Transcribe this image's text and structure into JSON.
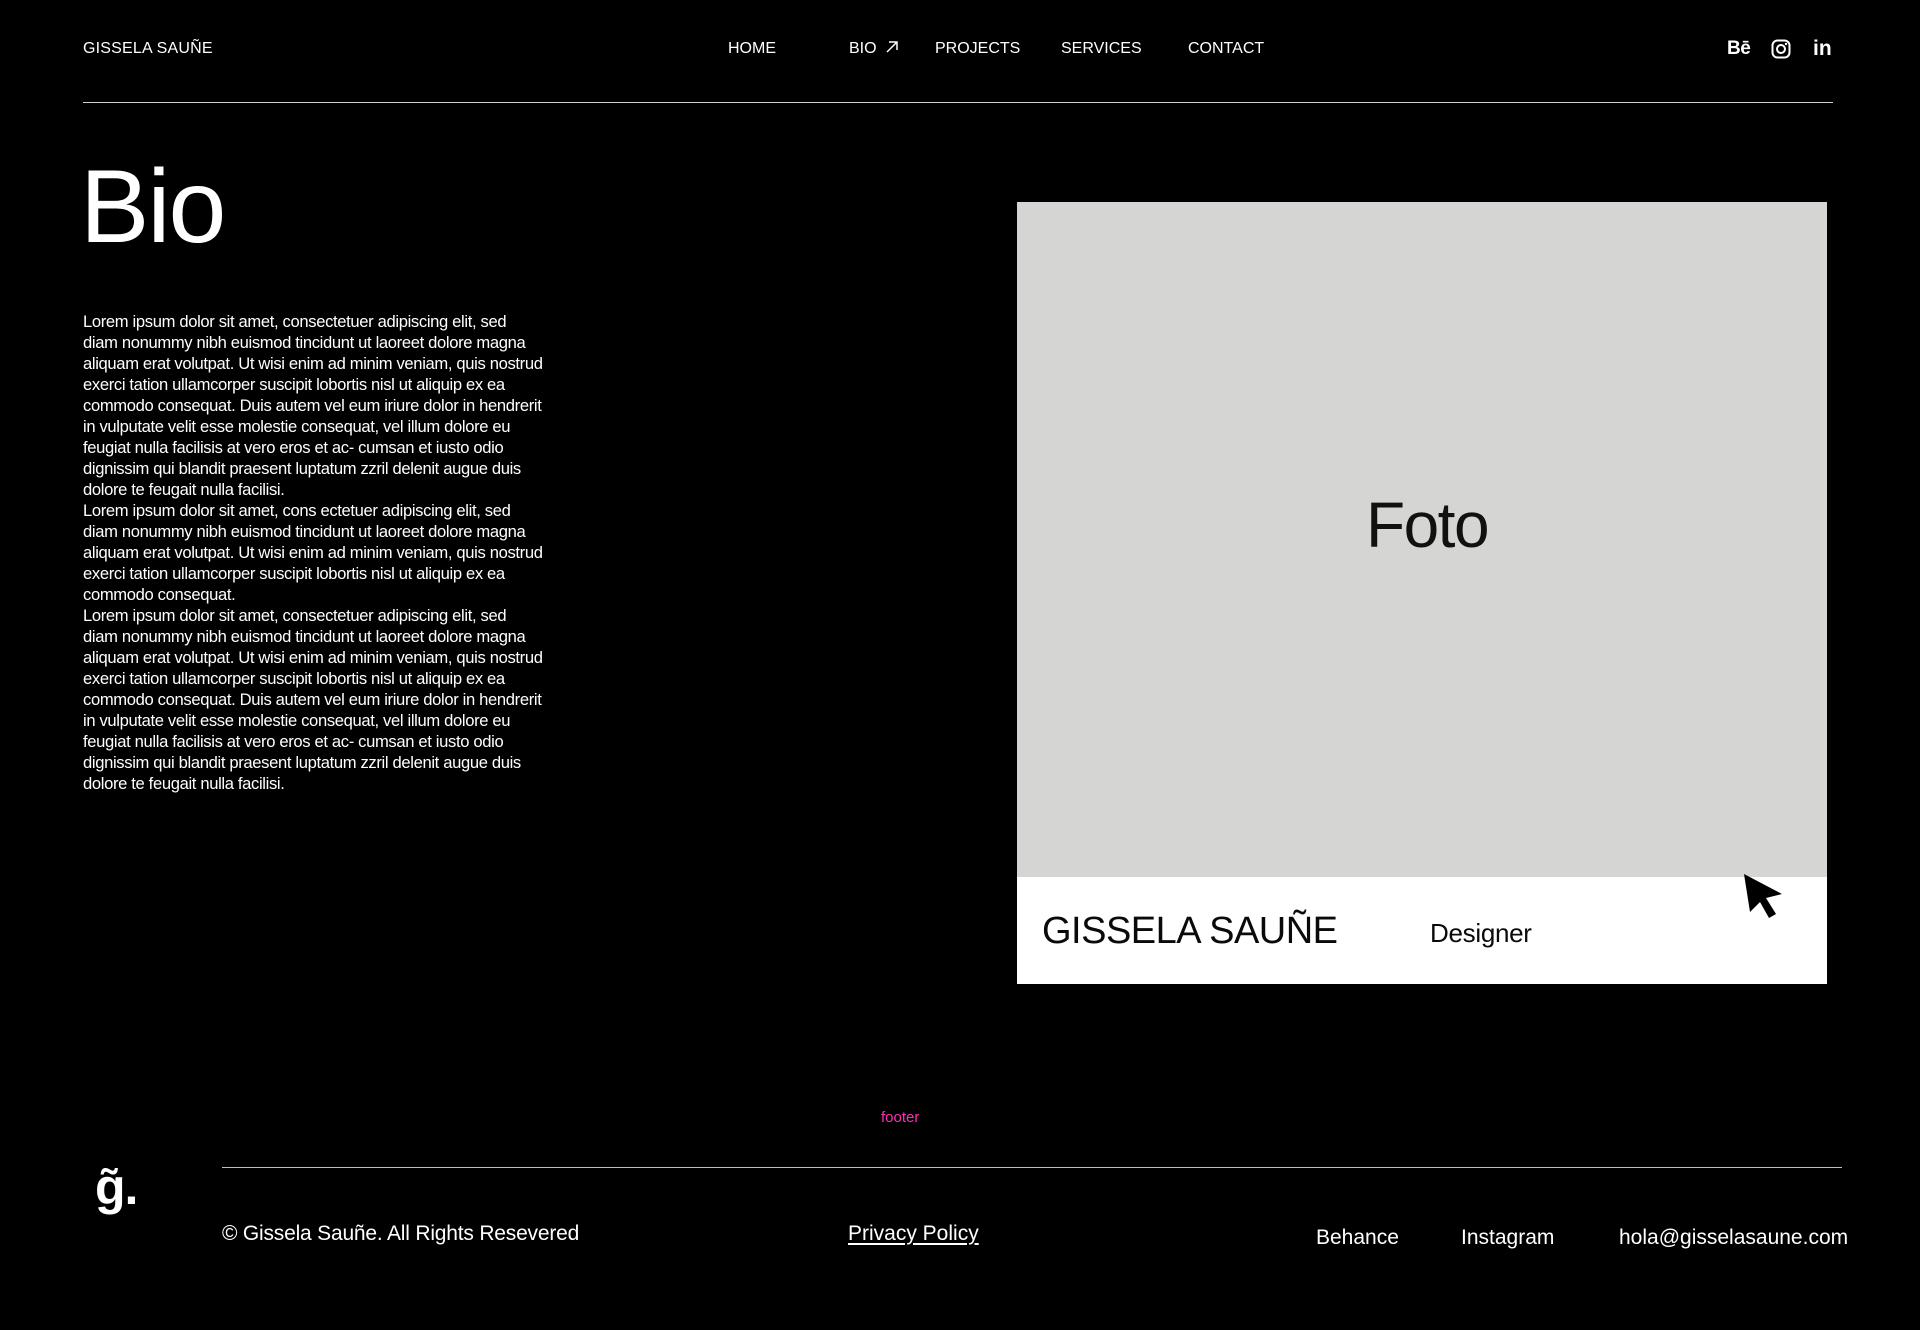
{
  "header": {
    "brand": "GISSELA SAUÑE",
    "nav": {
      "home": "HOME",
      "bio": "BIO",
      "projects": "PROJECTS",
      "services": "SERVICES",
      "contact": "CONTACT"
    },
    "social": {
      "behance": "Bē",
      "linkedin": "in"
    }
  },
  "main": {
    "title": "Bio",
    "paragraphs": [
      "Lorem ipsum dolor sit amet, consectetuer adipiscing elit, sed diam nonummy nibh euismod tincidunt ut laoreet dolore magna aliquam erat volutpat. Ut wisi enim ad minim veniam, quis nostrud exerci tation ullamcorper suscipit lobortis nisl ut aliquip ex ea commodo consequat. Duis autem vel eum iriure dolor in hendrerit in vulputate velit esse molestie consequat, vel illum dolore eu feugiat nulla facilisis at vero eros et ac- cumsan et iusto odio dignissim qui blandit praesent luptatum zzril delenit augue duis dolore te feugait nulla facilisi.",
      "Lorem ipsum dolor sit amet, cons ectetuer adipiscing elit, sed diam nonummy nibh euismod tincidunt ut laoreet dolore magna aliquam erat volutpat. Ut wisi enim ad minim veniam, quis nostrud exerci tation ullamcorper suscipit lobortis nisl ut aliquip ex ea commodo consequat.",
      "Lorem ipsum dolor sit amet, consectetuer adipiscing elit, sed diam nonummy nibh euismod tincidunt ut laoreet dolore magna aliquam erat volutpat. Ut wisi enim ad minim veniam, quis nostrud exerci tation ullamcorper suscipit lobortis nisl ut aliquip ex ea commodo consequat. Duis autem vel eum iriure dolor in hendrerit in vulputate velit esse molestie consequat, vel illum dolore eu feugiat nulla facilisis at vero eros et ac- cumsan et iusto odio dignissim qui blandit praesent luptatum zzril delenit augue duis dolore te feugait nulla facilisi."
    ],
    "card": {
      "photo_label": "Foto",
      "name": "GISSELA SAUÑE",
      "role": "Designer"
    }
  },
  "footer": {
    "tag": "footer",
    "logo": "g̃.",
    "copyright": "© Gissela Sauñe.  All Rights Resevered",
    "privacy": "Privacy Policy",
    "links": {
      "behance": "Behance",
      "instagram": "Instagram",
      "email": "hola@gisselasaune.com"
    }
  },
  "colors": {
    "background": "#000000",
    "text": "#ffffff",
    "photo_placeholder": "#d5d5d3",
    "footer_tag": "#ff2db3"
  }
}
